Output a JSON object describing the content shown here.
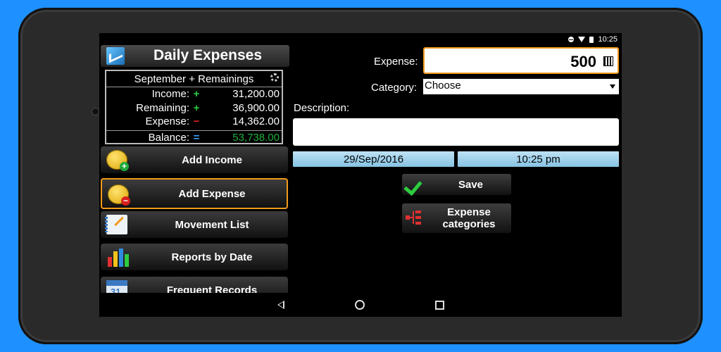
{
  "status_bar": {
    "time": "10:25"
  },
  "app": {
    "title": "Daily Expenses"
  },
  "summary": {
    "period": "September + Remainings",
    "rows": [
      {
        "label": "Income:",
        "sign": "+",
        "value": "31,200.00"
      },
      {
        "label": "Remaining:",
        "sign": "+",
        "value": "36,900.00"
      },
      {
        "label": "Expense:",
        "sign": "−",
        "value": "14,362.00"
      },
      {
        "label": "Balance:",
        "sign": "=",
        "value": "53,738.00"
      }
    ]
  },
  "menu": {
    "add_income": "Add Income",
    "add_expense": "Add Expense",
    "movement_list": "Movement List",
    "reports_by_date": "Reports by Date",
    "frequent_records": "Frequent Records"
  },
  "form": {
    "expense_label": "Expense:",
    "expense_value": "500",
    "category_label": "Category:",
    "category_value": "Choose",
    "description_label": "Description:",
    "description_value": "",
    "date": "29/Sep/2016",
    "time": "10:25 pm",
    "save": "Save",
    "expense_categories": "Expense categories"
  },
  "colors": {
    "accent": "#f29a1a",
    "background": "#1e90ff",
    "balance_text": "#1fae3a"
  }
}
